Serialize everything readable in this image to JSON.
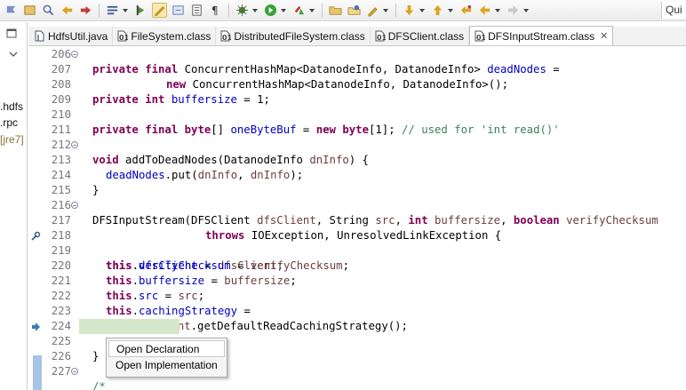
{
  "toolbar": {
    "buttons": [
      "open-type-icon",
      "open-task-icon",
      "search-icon",
      "annotation-prev-icon",
      "annotation-next-icon",
      "toggle-breadcrumb-icon",
      "mark-occurrences-icon",
      "word-wrap-icon",
      "show-whitespace-icon",
      "debug-icon",
      "run-icon",
      "external-tools-icon",
      "new-folder-icon",
      "new-java-project-icon",
      "pencil-icon",
      "next-annotation-icon",
      "previous-annotation-icon",
      "back-icon",
      "forward-icon"
    ],
    "quick_access": "Qui"
  },
  "left_panel": {
    "items": [
      ".hdfs",
      ".rpc",
      "[jre7]"
    ]
  },
  "tabs": [
    {
      "label": "HdfsUtil.java",
      "icon": "java-file-icon"
    },
    {
      "label": "FileSystem.class",
      "icon": "class-file-icon"
    },
    {
      "label": "DistributedFileSystem.class",
      "icon": "class-file-icon"
    },
    {
      "label": "DFSClient.class",
      "icon": "class-file-icon"
    },
    {
      "label": "DFSInputStream.class",
      "icon": "class-file-icon",
      "active": true,
      "close": "✕"
    }
  ],
  "lines": [
    {
      "n": "206",
      "fold": true
    },
    {
      "n": "207"
    },
    {
      "n": "208"
    },
    {
      "n": "209"
    },
    {
      "n": "210"
    },
    {
      "n": "211"
    },
    {
      "n": "212",
      "fold": true
    },
    {
      "n": "213"
    },
    {
      "n": "214"
    },
    {
      "n": "215"
    },
    {
      "n": "216",
      "fold": true
    },
    {
      "n": "217"
    },
    {
      "n": "218"
    },
    {
      "n": "219"
    },
    {
      "n": "220"
    },
    {
      "n": "221"
    },
    {
      "n": "222"
    },
    {
      "n": "223"
    },
    {
      "n": "224"
    },
    {
      "n": "225"
    },
    {
      "n": "226"
    },
    {
      "n": "227",
      "fold": true
    }
  ],
  "code": {
    "l206": {
      "kw1": "private final",
      "t": " ConcurrentHashMap<DatanodeInfo, DatanodeInfo> ",
      "f": "deadNodes",
      "e": " ="
    },
    "l207": {
      "kw1": "new",
      "t": " ConcurrentHashMap<DatanodeInfo, DatanodeInfo>();"
    },
    "l208": {
      "kw1": "private int",
      "f": "buffersize",
      "e": " = 1;"
    },
    "l210": {
      "kw1": "private final byte",
      "t": "[] ",
      "f": "oneByteBuf",
      "e": " = ",
      "kw2": "new byte",
      "e2": "[1]; ",
      "cm": "// used for 'int read()'"
    },
    "l212": {
      "kw1": "void",
      "t": " addToDeadNodes(DatanodeInfo ",
      "v": "dnInfo",
      "e": ") {"
    },
    "l213": {
      "f": "deadNodes",
      "t": ".put(",
      "v1": "dnInfo",
      "c": ", ",
      "v2": "dnInfo",
      "e": ");"
    },
    "l214": {
      "t": "}"
    },
    "l216": {
      "t": "DFSInputStream(DFSClient ",
      "v1": "dfsClient",
      "t2": ", String ",
      "v2": "src",
      "t3": ", ",
      "kw1": "int",
      "v3": "buffersize",
      "t4": ", ",
      "kw2": "boolean",
      "v4": "verifyChecksum"
    },
    "l217": {
      "kw1": "throws",
      "t": " IOException, UnresolvedLinkException {"
    },
    "l218": {
      "kw": "this",
      "f": "dfsClient",
      "e": " = ",
      "v": "dfsClient",
      "s": ";"
    },
    "l219": {
      "kw": "this",
      "f": "verifyChecksum",
      "e": " = ",
      "v": "verifyChecksum",
      "s": ";"
    },
    "l220": {
      "kw": "this",
      "f": "buffersize",
      "e": " = ",
      "v": "buffersize",
      "s": ";"
    },
    "l221": {
      "kw": "this",
      "f": "src",
      "e": " = ",
      "v": "src",
      "s": ";"
    },
    "l222": {
      "kw": "this",
      "f": "cachingStrategy",
      "e": " ="
    },
    "l223": {
      "v": "dfsClient",
      "t": ".getDefaultReadCachingStrategy();"
    },
    "l224": {
      "link": "openInfo",
      "t": "();"
    },
    "l225": {
      "t": "}"
    },
    "l227": {
      "cm": "/*"
    }
  },
  "context_menu": {
    "items": [
      {
        "label": "Open Declaration",
        "selected": true
      },
      {
        "label": "Open Implementation"
      }
    ]
  },
  "colors": {
    "keyword": "#7f0055",
    "field": "#0000c0",
    "local": "#6a3e3e",
    "comment": "#3f7f5f",
    "highlight": "#d4e8c9"
  }
}
